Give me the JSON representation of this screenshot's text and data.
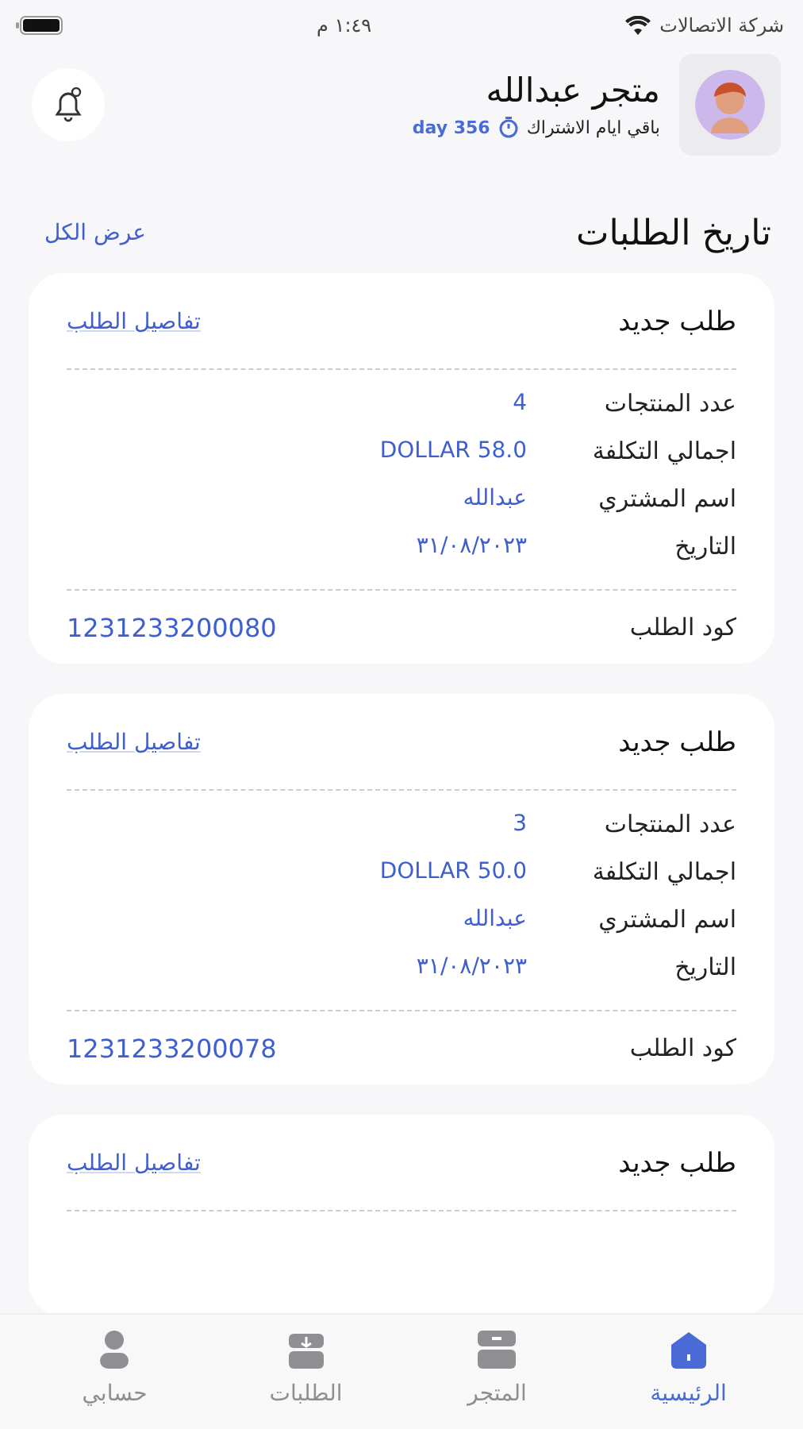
{
  "status_bar": {
    "carrier": "شركة الاتصالات",
    "time": "١:٤٩ م"
  },
  "header": {
    "store_name": "متجر عبدالله",
    "subscription_label": "باقي ايام الاشتراك",
    "days_left": "day 356"
  },
  "section": {
    "title": "تاريخ الطلبات",
    "view_all": "عرض الكل"
  },
  "orders": [
    {
      "status": "طلب جديد",
      "details_link": "تفاصيل الطلب",
      "rows": [
        {
          "label": "عدد المنتجات",
          "value": "4"
        },
        {
          "label": "اجمالي التكلفة",
          "value": "DOLLAR 58.0"
        },
        {
          "label": "اسم المشتري",
          "value": "عبدالله"
        },
        {
          "label": "التاريخ",
          "value": "٣١/٠٨/٢٠٢٣"
        }
      ],
      "code_label": "كود الطلب",
      "code": "1231233200080"
    },
    {
      "status": "طلب جديد",
      "details_link": "تفاصيل الطلب",
      "rows": [
        {
          "label": "عدد المنتجات",
          "value": "3"
        },
        {
          "label": "اجمالي التكلفة",
          "value": "DOLLAR 50.0"
        },
        {
          "label": "اسم المشتري",
          "value": "عبدالله"
        },
        {
          "label": "التاريخ",
          "value": "٣١/٠٨/٢٠٢٣"
        }
      ],
      "code_label": "كود الطلب",
      "code": "1231233200078"
    },
    {
      "status": "طلب جديد",
      "details_link": "تفاصيل الطلب"
    }
  ],
  "bottom_nav": [
    {
      "kind": "home",
      "label": "الرئيسية",
      "selected": true
    },
    {
      "kind": "store",
      "label": "المتجر",
      "selected": false
    },
    {
      "kind": "orders",
      "label": "الطلبات",
      "selected": false
    },
    {
      "kind": "account",
      "label": "حسابي",
      "selected": false
    }
  ]
}
